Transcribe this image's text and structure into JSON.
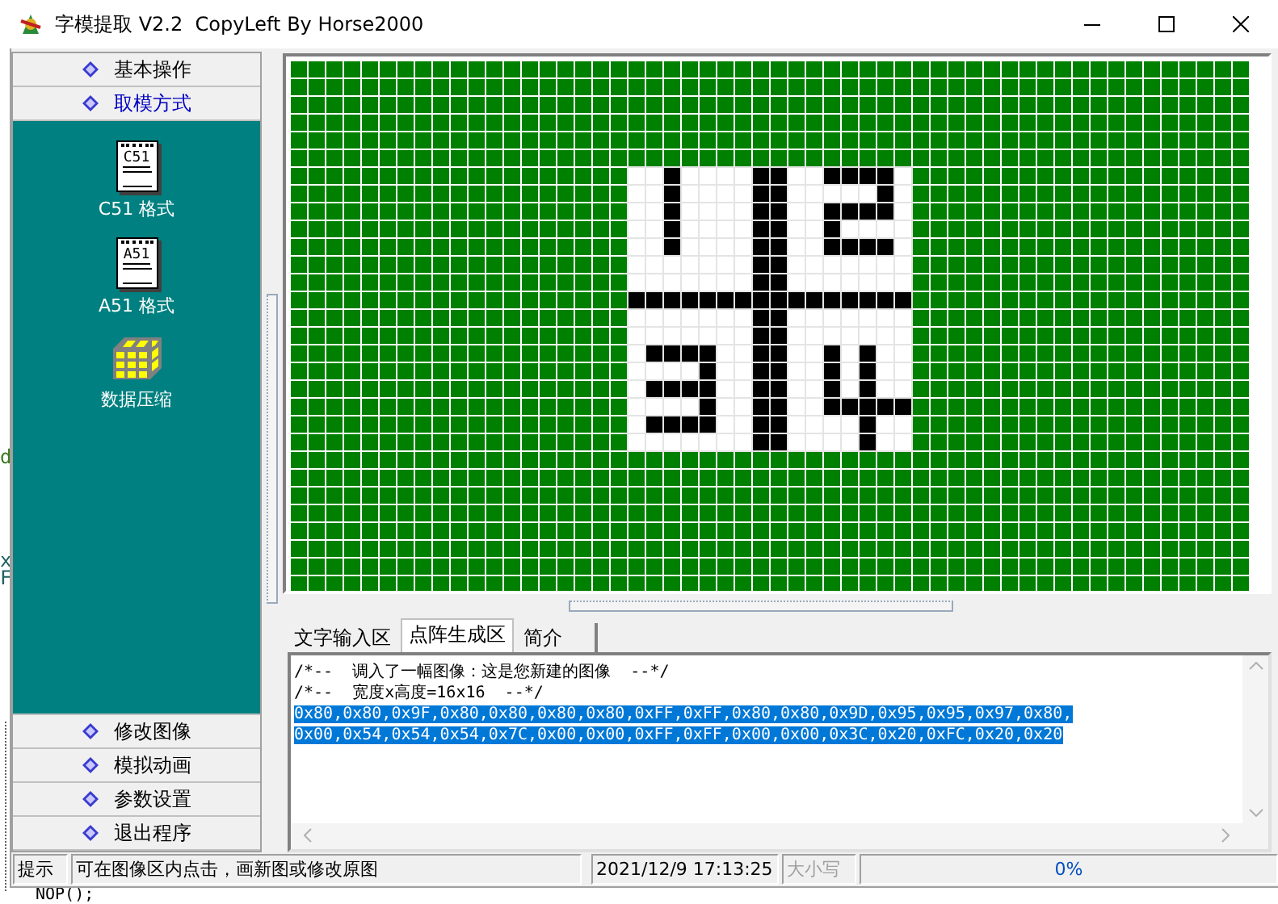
{
  "window": {
    "title": "字模提取 V2.2  CopyLeft By Horse2000"
  },
  "background_text": [
    "d",
    "x",
    "F",
    "NOP();"
  ],
  "sidebar": {
    "sections": [
      {
        "label": "基本操作",
        "expanded": false
      },
      {
        "label": "取模方式",
        "expanded": true,
        "items": [
          {
            "label": "C51 格式",
            "kind": "notepad",
            "badge": "C51"
          },
          {
            "label": "A51 格式",
            "kind": "notepad",
            "badge": "A51"
          },
          {
            "label": "数据压缩",
            "kind": "cube"
          }
        ]
      },
      {
        "label": "修改图像",
        "expanded": false
      },
      {
        "label": "模拟动画",
        "expanded": false
      },
      {
        "label": "参数设置",
        "expanded": false
      },
      {
        "label": "退出程序",
        "expanded": false
      }
    ]
  },
  "canvas": {
    "image_rows": [
      [
        false,
        false,
        true,
        false,
        false,
        false,
        false,
        true,
        true,
        false,
        false,
        true,
        true,
        true,
        true,
        false
      ],
      [
        false,
        false,
        true,
        false,
        false,
        false,
        false,
        true,
        true,
        false,
        false,
        false,
        false,
        false,
        true,
        false
      ],
      [
        false,
        false,
        true,
        false,
        false,
        false,
        false,
        true,
        true,
        false,
        false,
        true,
        true,
        true,
        true,
        false
      ],
      [
        false,
        false,
        true,
        false,
        false,
        false,
        false,
        true,
        true,
        false,
        false,
        true,
        false,
        false,
        false,
        false
      ],
      [
        false,
        false,
        true,
        false,
        false,
        false,
        false,
        true,
        true,
        false,
        false,
        true,
        true,
        true,
        true,
        false
      ],
      [
        false,
        false,
        false,
        false,
        false,
        false,
        false,
        true,
        true,
        false,
        false,
        false,
        false,
        false,
        false,
        false
      ],
      [
        false,
        false,
        false,
        false,
        false,
        false,
        false,
        true,
        true,
        false,
        false,
        false,
        false,
        false,
        false,
        false
      ],
      [
        true,
        true,
        true,
        true,
        true,
        true,
        true,
        true,
        true,
        true,
        true,
        true,
        true,
        true,
        true,
        true
      ],
      [
        false,
        false,
        false,
        false,
        false,
        false,
        false,
        true,
        true,
        false,
        false,
        false,
        false,
        false,
        false,
        false
      ],
      [
        false,
        false,
        false,
        false,
        false,
        false,
        false,
        true,
        true,
        false,
        false,
        false,
        false,
        false,
        false,
        false
      ],
      [
        false,
        true,
        true,
        true,
        true,
        false,
        false,
        true,
        true,
        false,
        false,
        true,
        false,
        true,
        false,
        false
      ],
      [
        false,
        false,
        false,
        false,
        true,
        false,
        false,
        true,
        true,
        false,
        false,
        true,
        false,
        true,
        false,
        false
      ],
      [
        false,
        true,
        true,
        true,
        true,
        false,
        false,
        true,
        true,
        false,
        false,
        true,
        false,
        true,
        false,
        false
      ],
      [
        false,
        false,
        false,
        false,
        true,
        false,
        false,
        true,
        true,
        false,
        false,
        true,
        true,
        true,
        true,
        true
      ],
      [
        false,
        true,
        true,
        true,
        true,
        false,
        false,
        true,
        true,
        false,
        false,
        false,
        false,
        true,
        false,
        false
      ],
      [
        false,
        false,
        false,
        false,
        false,
        false,
        false,
        true,
        true,
        false,
        false,
        false,
        false,
        true,
        false,
        false
      ]
    ]
  },
  "tabs": [
    {
      "label": "文字输入区",
      "selected": false
    },
    {
      "label": "点阵生成区",
      "selected": true
    },
    {
      "label": "简介",
      "selected": false
    }
  ],
  "output": {
    "lines": [
      {
        "text": "/*--  调入了一幅图像：这是您新建的图像  --*/",
        "selected": false
      },
      {
        "text": "/*--  宽度x高度=16x16  --*/",
        "selected": false
      },
      {
        "text": "0x80,0x80,0x9F,0x80,0x80,0x80,0x80,0xFF,0xFF,0x80,0x80,0x9D,0x95,0x95,0x97,0x80,",
        "selected": true
      },
      {
        "text": "0x00,0x54,0x54,0x54,0x7C,0x00,0x00,0xFF,0xFF,0x00,0x00,0x3C,0x20,0xFC,0x20,0x20",
        "selected": true
      }
    ]
  },
  "status_bar": {
    "label": "提示",
    "message": "可在图像区内点击，画新图或修改原图",
    "datetime": "2021/12/9 17:13:25",
    "caps": {
      "text": "大小写",
      "on": false
    },
    "progress": {
      "level": 0,
      "reading": "0%"
    }
  }
}
